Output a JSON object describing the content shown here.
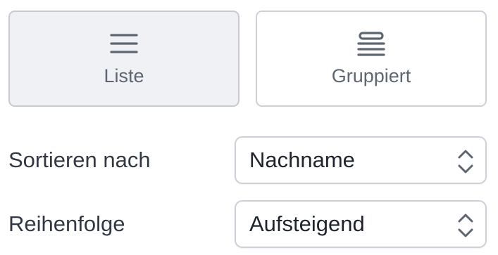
{
  "view_toggle": {
    "list": {
      "label": "Liste",
      "icon": "list-lines-icon",
      "selected": true
    },
    "grouped": {
      "label": "Gruppiert",
      "icon": "grouped-list-icon",
      "selected": false
    }
  },
  "sort": {
    "label": "Sortieren nach",
    "value": "Nachname",
    "icon": "up-down-chevron-icon"
  },
  "order": {
    "label": "Reihenfolge",
    "value": "Aufsteigend",
    "icon": "up-down-chevron-icon"
  },
  "colors": {
    "selected_background": "#f0f1f4",
    "border": "#cdd0d6",
    "icon": "#5e6672",
    "label_text": "#323843"
  }
}
